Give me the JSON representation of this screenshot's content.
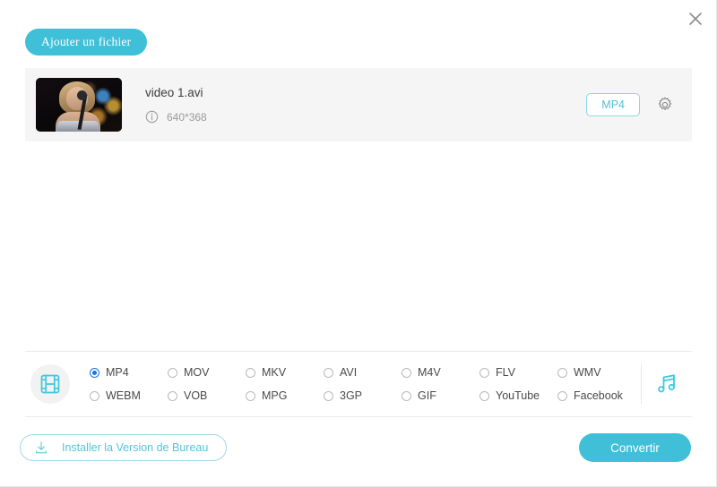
{
  "window": {
    "close_label": "✕"
  },
  "toolbar": {
    "add_file_label": "Ajouter un fichier"
  },
  "file_list": {
    "items": [
      {
        "name": "video 1.avi",
        "resolution": "640*368",
        "output_format": "MP4"
      }
    ]
  },
  "format_picker": {
    "video_icon": "film-strip-icon",
    "audio_icon": "music-note-icon",
    "selected": "MP4",
    "options": [
      "MP4",
      "MOV",
      "MKV",
      "AVI",
      "M4V",
      "FLV",
      "WMV",
      "WEBM",
      "VOB",
      "MPG",
      "3GP",
      "GIF",
      "YouTube",
      "Facebook"
    ]
  },
  "footer": {
    "install_label": "Installer la Version de Bureau",
    "convert_label": "Convertir"
  },
  "colors": {
    "accent": "#3fc0d8",
    "accent_light": "#53c5d8",
    "radio_checked": "#1a73e8",
    "row_bg": "#f5f5f5"
  }
}
